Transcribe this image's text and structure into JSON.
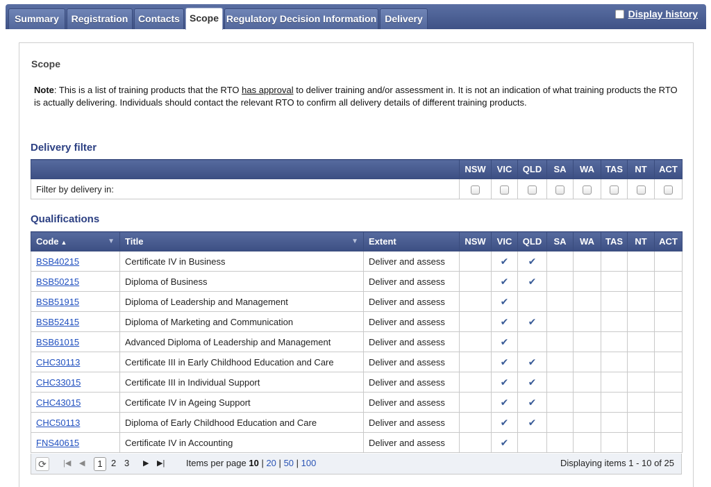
{
  "tabs": [
    {
      "label": "Summary",
      "active": false
    },
    {
      "label": "Registration",
      "active": false
    },
    {
      "label": "Contacts",
      "active": false
    },
    {
      "label": "Scope",
      "active": true
    },
    {
      "label": "Regulatory Decision Information",
      "active": false
    },
    {
      "label": "Delivery",
      "active": false
    }
  ],
  "display_history": "Display history",
  "section_title": "Scope",
  "note": {
    "label": "Note",
    "text_before": ": This is a list of training products that the RTO ",
    "underlined": "has approval",
    "text_after": " to deliver training and/or assessment in.  It is not an indication of what training products the RTO is actually delivering.  Individuals should contact the relevant RTO to confirm all delivery details of different training products."
  },
  "delivery_filter": {
    "heading": "Delivery filter",
    "row_label": "Filter by delivery in:",
    "states": [
      "NSW",
      "VIC",
      "QLD",
      "SA",
      "WA",
      "TAS",
      "NT",
      "ACT"
    ]
  },
  "qualifications": {
    "heading": "Qualifications",
    "columns": {
      "code": "Code",
      "title": "Title",
      "extent": "Extent"
    },
    "states": [
      "NSW",
      "VIC",
      "QLD",
      "SA",
      "WA",
      "TAS",
      "NT",
      "ACT"
    ],
    "tick_symbol": "✔",
    "rows": [
      {
        "code": "BSB40215",
        "title": "Certificate IV in Business",
        "extent": "Deliver and assess",
        "ticks": [
          false,
          true,
          true,
          false,
          false,
          false,
          false,
          false
        ]
      },
      {
        "code": "BSB50215",
        "title": "Diploma of Business",
        "extent": "Deliver and assess",
        "ticks": [
          false,
          true,
          true,
          false,
          false,
          false,
          false,
          false
        ]
      },
      {
        "code": "BSB51915",
        "title": "Diploma of Leadership and Management",
        "extent": "Deliver and assess",
        "ticks": [
          false,
          true,
          false,
          false,
          false,
          false,
          false,
          false
        ]
      },
      {
        "code": "BSB52415",
        "title": "Diploma of Marketing and Communication",
        "extent": "Deliver and assess",
        "ticks": [
          false,
          true,
          true,
          false,
          false,
          false,
          false,
          false
        ]
      },
      {
        "code": "BSB61015",
        "title": "Advanced Diploma of Leadership and Management",
        "extent": "Deliver and assess",
        "ticks": [
          false,
          true,
          false,
          false,
          false,
          false,
          false,
          false
        ]
      },
      {
        "code": "CHC30113",
        "title": "Certificate III in Early Childhood Education and Care",
        "extent": "Deliver and assess",
        "ticks": [
          false,
          true,
          true,
          false,
          false,
          false,
          false,
          false
        ]
      },
      {
        "code": "CHC33015",
        "title": "Certificate III in Individual Support",
        "extent": "Deliver and assess",
        "ticks": [
          false,
          true,
          true,
          false,
          false,
          false,
          false,
          false
        ]
      },
      {
        "code": "CHC43015",
        "title": "Certificate IV in Ageing Support",
        "extent": "Deliver and assess",
        "ticks": [
          false,
          true,
          true,
          false,
          false,
          false,
          false,
          false
        ]
      },
      {
        "code": "CHC50113",
        "title": "Diploma of Early Childhood Education and Care",
        "extent": "Deliver and assess",
        "ticks": [
          false,
          true,
          true,
          false,
          false,
          false,
          false,
          false
        ]
      },
      {
        "code": "FNS40615",
        "title": "Certificate IV in Accounting",
        "extent": "Deliver and assess",
        "ticks": [
          false,
          true,
          false,
          false,
          false,
          false,
          false,
          false
        ]
      }
    ]
  },
  "pager": {
    "pages": [
      "1",
      "2",
      "3"
    ],
    "current_page": "1",
    "items_per_page_label": "Items per page",
    "page_sizes": [
      "10",
      "20",
      "50",
      "100"
    ],
    "selected_page_size": "10",
    "separator": "|",
    "display_text": "Displaying items 1 - 10 of 25"
  },
  "colors": {
    "header_blue": "#3c4f83",
    "heading_blue": "#2b3f82",
    "link_blue": "#1f4fbf",
    "tick_blue": "#3a5c98"
  }
}
